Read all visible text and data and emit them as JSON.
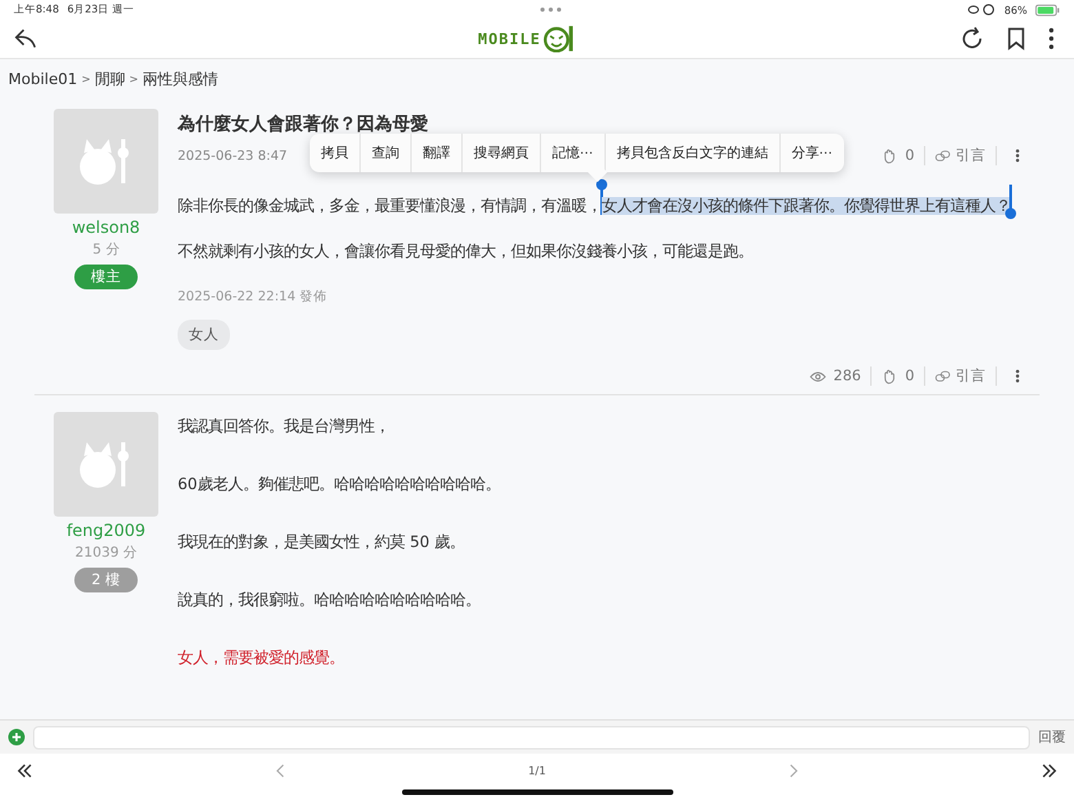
{
  "status_bar": {
    "time": "上午8:48",
    "date": "6月23日 週一",
    "battery": "86%"
  },
  "nav": {
    "logo_text": "MOBILE"
  },
  "breadcrumb": [
    {
      "label": "Mobile01"
    },
    {
      "separator": ">",
      "label": "閒聊"
    },
    {
      "separator": ">",
      "label": "兩性與感情"
    }
  ],
  "posts": [
    {
      "author": "welson8",
      "score": "5 分",
      "floor": "樓主",
      "is_op": true,
      "title": "為什麼女人會跟著你？因為母愛",
      "date": "2025-06-23 8:47",
      "top_stats": {
        "likes": "0",
        "quote": "引言"
      },
      "paragraphs": [
        {
          "text": "除非你長的像金城武，多金，最重要懂浪漫，有情調，有溫暖，",
          "selected_text": "女人才會在沒小孩的條件下跟著你。你覺得世界上有這種人？",
          "kind": "normal"
        },
        {
          "text": "不然就剩有小孩的女人，會讓你看見母愛的偉大，但如果你沒錢養小孩，可能還是跑。",
          "kind": "normal"
        }
      ],
      "posted": "2025-06-22 22:14 發佈",
      "tags": [
        "女人"
      ],
      "stats": {
        "views": "286",
        "likes": "0",
        "quote": "引言"
      }
    },
    {
      "author": "feng2009",
      "score": "21039 分",
      "floor": "2 樓",
      "is_op": false,
      "paragraphs": [
        {
          "text": "我認真回答你。我是台灣男性，",
          "kind": "normal"
        },
        {
          "text": "60歲老人。夠催悲吧。哈哈哈哈哈哈哈哈哈哈。",
          "kind": "normal"
        },
        {
          "text": "我現在的對象，是美國女性，約莫 50 歲。",
          "kind": "normal"
        },
        {
          "text": "說真的，我很窮啦。哈哈哈哈哈哈哈哈哈哈。",
          "kind": "normal"
        },
        {
          "text": "女人，需要被愛的感覺。",
          "kind": "emphasis"
        }
      ]
    }
  ],
  "context_menu": [
    "拷貝",
    "查詢",
    "翻譯",
    "搜尋網頁",
    "記憶⋯",
    "拷貝包含反白文字的連結",
    "分享⋯"
  ],
  "reply_bar": {
    "button": "回覆"
  },
  "pager": {
    "page": "1/1"
  }
}
